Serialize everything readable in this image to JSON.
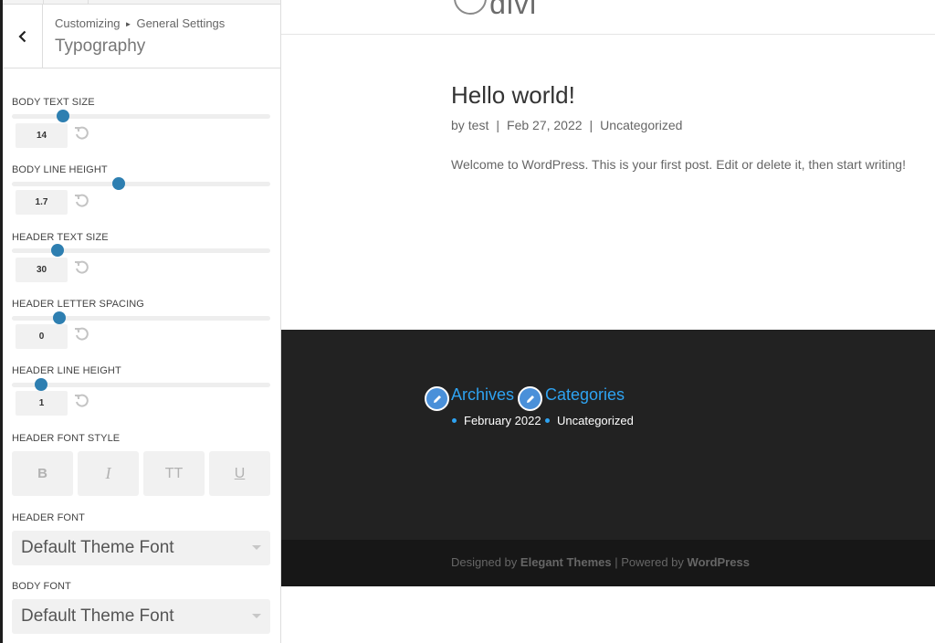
{
  "customizer": {
    "breadcrumb": {
      "part1": "Customizing",
      "part2": "General Settings"
    },
    "title": "Typography",
    "controls": {
      "body_text_size": {
        "label": "BODY TEXT SIZE",
        "value": "14"
      },
      "body_line_height": {
        "label": "BODY LINE HEIGHT",
        "value": "1.7"
      },
      "header_text_size": {
        "label": "HEADER TEXT SIZE",
        "value": "30"
      },
      "header_letter_spacing": {
        "label": "HEADER LETTER SPACING",
        "value": "0"
      },
      "header_line_height": {
        "label": "HEADER LINE HEIGHT",
        "value": "1"
      }
    },
    "header_font_style": {
      "label": "HEADER FONT STYLE",
      "buttons": {
        "bold": "B",
        "italic": "I",
        "uppercase": "TT",
        "underline": "U"
      }
    },
    "header_font": {
      "label": "HEADER FONT",
      "value": "Default Theme Font"
    },
    "body_font": {
      "label": "BODY FONT",
      "value": "Default Theme Font"
    },
    "accent_color": "#2e7fb1"
  },
  "preview": {
    "logo": "divi",
    "post": {
      "title": "Hello world!",
      "meta": {
        "prefix": "by",
        "author": "test",
        "date": "Feb 27, 2022",
        "category": "Uncategorized",
        "separator": "|"
      },
      "body": "Welcome to WordPress. This is your first post. Edit or delete it, then start writing!"
    },
    "footer": {
      "widgets": [
        {
          "title": "Archives",
          "item": "February 2022"
        },
        {
          "title": "Categories",
          "item": "Uncategorized"
        }
      ],
      "link_color": "#2ea3f2"
    },
    "credits": {
      "designed_by": "Designed by",
      "designer": "Elegant Themes",
      "separator": "|",
      "powered_by": "Powered by",
      "platform": "WordPress"
    }
  }
}
